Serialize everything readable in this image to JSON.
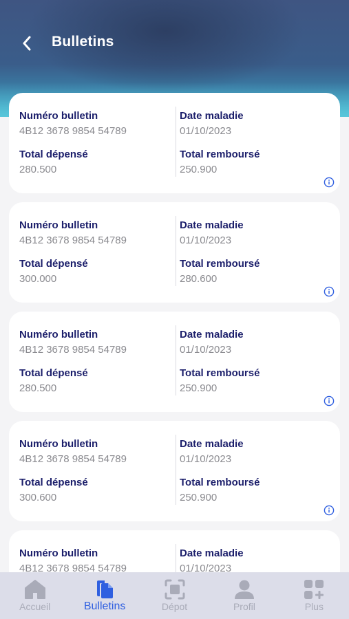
{
  "header": {
    "title": "Bulletins"
  },
  "labels": {
    "numero": "Numéro bulletin",
    "date": "Date maladie",
    "depense": "Total dépensé",
    "rembourse": "Total remboursé"
  },
  "bulletins": [
    {
      "numero": "4B12 3678 9854 54789",
      "date": "01/10/2023",
      "depense": "280.500",
      "rembourse": "250.900"
    },
    {
      "numero": "4B12 3678 9854 54789",
      "date": "01/10/2023",
      "depense": "300.000",
      "rembourse": "280.600"
    },
    {
      "numero": "4B12 3678 9854 54789",
      "date": "01/10/2023",
      "depense": "280.500",
      "rembourse": "250.900"
    },
    {
      "numero": "4B12 3678 9854 54789",
      "date": "01/10/2023",
      "depense": "300.600",
      "rembourse": "250.900"
    },
    {
      "numero": "4B12 3678 9854 54789",
      "date": "01/10/2023",
      "depense": "",
      "rembourse": ""
    }
  ],
  "tabs": [
    {
      "label": "Accueil",
      "icon": "home-icon",
      "active": false
    },
    {
      "label": "Bulletins",
      "icon": "document-icon",
      "active": true
    },
    {
      "label": "Dépot",
      "icon": "scan-icon",
      "active": false
    },
    {
      "label": "Profil",
      "icon": "user-icon",
      "active": false
    },
    {
      "label": "Plus",
      "icon": "grid-plus-icon",
      "active": false
    }
  ],
  "colors": {
    "label": "#1c1f6b",
    "value": "#8a8a8f",
    "accent": "#2f5fe0",
    "tab_inactive": "#a9abb8",
    "tab_bar": "#dcdde9"
  }
}
